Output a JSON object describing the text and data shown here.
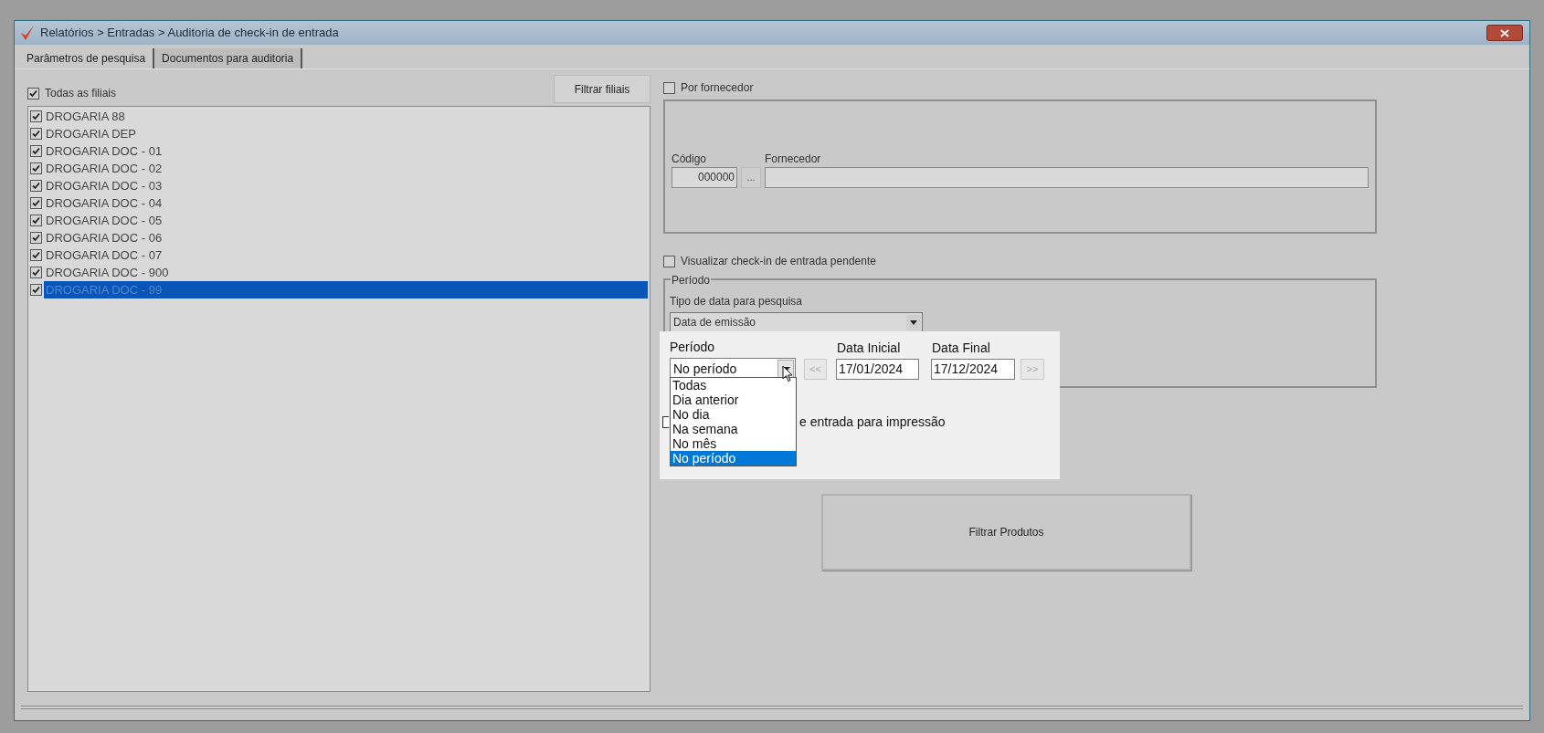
{
  "window": {
    "title": "Relatórios > Entradas > Auditoria de check-in de entrada"
  },
  "tabs": [
    {
      "label": "Parâmetros de pesquisa",
      "selected": true
    },
    {
      "label": "Documentos para auditoria",
      "selected": false
    }
  ],
  "branches": {
    "all": {
      "label": "Todas as filiais",
      "checked": true
    },
    "filter_button": "Filtrar filiais",
    "items": [
      {
        "label": "DROGARIA 88",
        "checked": true,
        "selected": false
      },
      {
        "label": "DROGARIA DEP",
        "checked": true,
        "selected": false
      },
      {
        "label": "DROGARIA DOC - 01",
        "checked": true,
        "selected": false
      },
      {
        "label": "DROGARIA DOC - 02",
        "checked": true,
        "selected": false
      },
      {
        "label": "DROGARIA DOC - 03",
        "checked": true,
        "selected": false
      },
      {
        "label": "DROGARIA DOC - 04",
        "checked": true,
        "selected": false
      },
      {
        "label": "DROGARIA DOC - 05",
        "checked": true,
        "selected": false
      },
      {
        "label": "DROGARIA DOC - 06",
        "checked": true,
        "selected": false
      },
      {
        "label": "DROGARIA DOC - 07",
        "checked": true,
        "selected": false
      },
      {
        "label": "DROGARIA DOC - 900",
        "checked": true,
        "selected": false
      },
      {
        "label": "DROGARIA DOC - 99",
        "checked": true,
        "selected": true
      }
    ]
  },
  "supplier": {
    "label": "Por fornecedor",
    "checked": false,
    "code_label": "Código",
    "code_value": "000000",
    "lookup_button": "...",
    "name_label": "Fornecedor"
  },
  "pending": {
    "label": "Visualizar check-in de entrada pendente",
    "checked": false
  },
  "period_group": {
    "title": "Período",
    "date_type_label": "Tipo de data para pesquisa",
    "date_type_value": "Data de emissão"
  },
  "period": {
    "label": "Período",
    "value": "No período",
    "prev_button": "<<",
    "start_label": "Data Inicial",
    "start_value": "17/01/2024",
    "end_label": "Data Final",
    "end_value": "17/12/2024",
    "next_button": ">>",
    "expanded": true,
    "options": [
      {
        "label": "Todas",
        "selected": false
      },
      {
        "label": "Dia anterior",
        "selected": false
      },
      {
        "label": "No dia",
        "selected": false
      },
      {
        "label": "Na semana",
        "selected": false
      },
      {
        "label": "No mês",
        "selected": false
      },
      {
        "label": "No período",
        "selected": true
      }
    ]
  },
  "print_option": {
    "label": "e entrada para impressão",
    "checked": false
  },
  "filter_products_button": "Filtrar Produtos"
}
